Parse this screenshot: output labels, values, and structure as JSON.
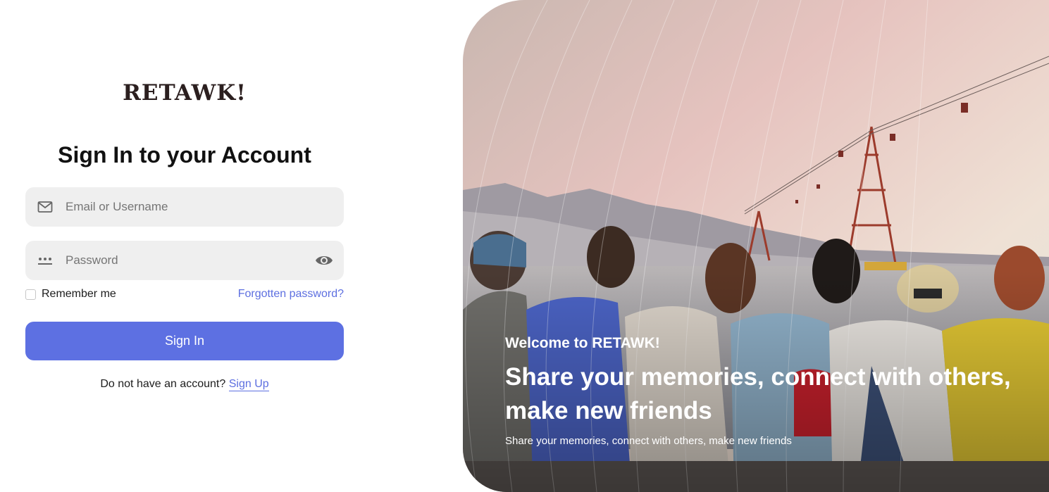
{
  "brand": {
    "logo": "RETAWK!"
  },
  "form": {
    "title": "Sign In to your Account",
    "email_placeholder": "Email or Username",
    "password_placeholder": "Password",
    "remember_label": "Remember me",
    "forgot_label": "Forgotten password?",
    "signin_label": "Sign In",
    "no_account_text": "Do not have an account?",
    "signup_label": "Sign Up"
  },
  "hero": {
    "welcome": "Welcome to RETAWK!",
    "headline": "Share your memories, connect with others, make new friends",
    "subline": "Share your memories, connect with others, make new friends"
  },
  "icons": {
    "email": "mail-icon",
    "password": "password-dots-icon",
    "toggle": "eye-icon"
  },
  "colors": {
    "accent": "#5d70e2",
    "link": "#5d6fe0",
    "field_bg": "#efefef"
  }
}
